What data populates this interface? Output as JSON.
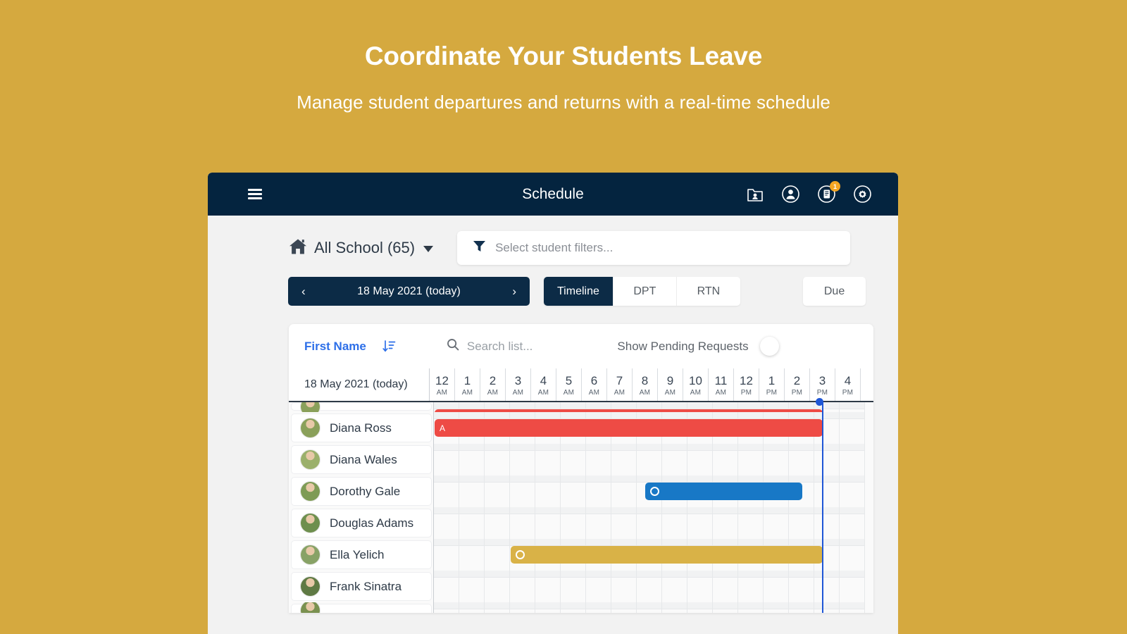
{
  "hero": {
    "title": "Coordinate Your Students Leave",
    "subtitle": "Manage student departures and returns with a real-time schedule",
    "bg_color": "#D5A93F"
  },
  "topbar": {
    "title": "Schedule",
    "bg_color": "#04243F",
    "menu_icon": "hamburger-icon",
    "icons": [
      {
        "name": "folder-user-icon",
        "badge": null
      },
      {
        "name": "user-circle-icon",
        "badge": null
      },
      {
        "name": "document-circle-icon",
        "badge": "1"
      },
      {
        "name": "gear-circle-icon",
        "badge": null
      }
    ]
  },
  "filters": {
    "school_label": "All School (65)",
    "school_icon": "home-icon",
    "filter_icon": "funnel-icon",
    "filter_placeholder": "Select student filters..."
  },
  "date_nav": {
    "prev": "‹",
    "label": "18 May 2021 (today)",
    "next": "›"
  },
  "view_tabs": [
    {
      "label": "Timeline",
      "active": true
    },
    {
      "label": "DPT",
      "active": false
    },
    {
      "label": "RTN",
      "active": false
    }
  ],
  "due_tab": {
    "label": "Due"
  },
  "list_toolbar": {
    "sort_label": "First Name",
    "sort_icon": "sort-descending-icon",
    "search_icon": "search-icon",
    "search_placeholder": "Search list...",
    "search_value": "",
    "pending_label": "Show Pending Requests",
    "pending_toggle_on": false
  },
  "timeline": {
    "date_label": "18 May 2021 (today)",
    "hours": [
      {
        "h": "12",
        "m": "AM"
      },
      {
        "h": "1",
        "m": "AM"
      },
      {
        "h": "2",
        "m": "AM"
      },
      {
        "h": "3",
        "m": "AM"
      },
      {
        "h": "4",
        "m": "AM"
      },
      {
        "h": "5",
        "m": "AM"
      },
      {
        "h": "6",
        "m": "AM"
      },
      {
        "h": "7",
        "m": "AM"
      },
      {
        "h": "8",
        "m": "AM"
      },
      {
        "h": "9",
        "m": "AM"
      },
      {
        "h": "10",
        "m": "AM"
      },
      {
        "h": "11",
        "m": "AM"
      },
      {
        "h": "12",
        "m": "PM"
      },
      {
        "h": "1",
        "m": "PM"
      },
      {
        "h": "2",
        "m": "PM"
      },
      {
        "h": "3",
        "m": "PM"
      },
      {
        "h": "4",
        "m": "PM"
      }
    ],
    "now_marker_hour": 15.3,
    "rows": [
      {
        "name": "",
        "partial": "top",
        "bars": [
          {
            "start": 0,
            "end": 15.3,
            "color": "red",
            "marker": "letter",
            "label": "A"
          }
        ]
      },
      {
        "name": "Diana Ross",
        "avatar_color": "#8AA05A",
        "bars": [
          {
            "start": 0,
            "end": 15.3,
            "color": "red",
            "marker": "letter",
            "label": "A"
          }
        ]
      },
      {
        "name": "Diana Wales",
        "avatar_color": "#9BB06B",
        "bars": []
      },
      {
        "name": "Dorothy Gale",
        "avatar_color": "#7E9B55",
        "bars": [
          {
            "start": 8.3,
            "end": 14.5,
            "color": "blue",
            "marker": "circle",
            "label": ""
          }
        ]
      },
      {
        "name": "Douglas Adams",
        "avatar_color": "#6E8F4E",
        "bars": []
      },
      {
        "name": "Ella Yelich",
        "avatar_color": "#88A266",
        "bars": [
          {
            "start": 3.0,
            "end": 15.3,
            "color": "gold",
            "marker": "circle",
            "label": ""
          }
        ]
      },
      {
        "name": "Frank Sinatra",
        "avatar_color": "#5F7A44",
        "bars": []
      },
      {
        "name": "",
        "partial": "bottom",
        "avatar_color": "#7A9150",
        "bars": []
      }
    ]
  },
  "colors": {
    "accent_gold": "#D5A93F",
    "navy": "#04243F",
    "tab_navy": "#0C2B46",
    "link_blue": "#2D6FE8",
    "bar_red": "#EE4B45",
    "bar_blue": "#1878C6",
    "bar_gold": "#D9B247",
    "now_line": "#1E56D6"
  }
}
